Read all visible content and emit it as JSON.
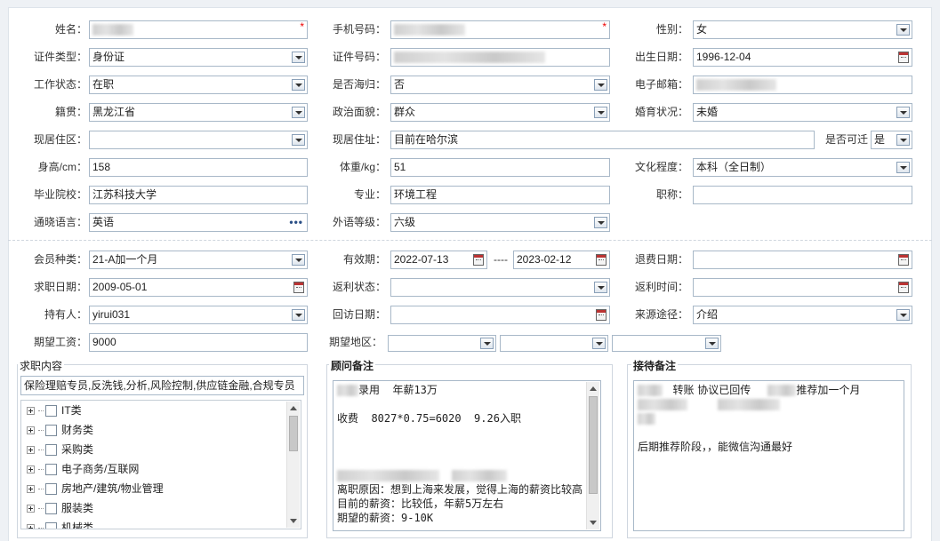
{
  "personal": {
    "name_label": "姓名：",
    "phone_label": "手机号码：",
    "gender_label": "性别：",
    "gender_value": "女",
    "id_type_label": "证件类型：",
    "id_type_value": "身份证",
    "id_no_label": "证件号码：",
    "birth_label": "出生日期：",
    "birth_value": "1996-12-04",
    "work_status_label": "工作状态：",
    "work_status_value": "在职",
    "overseas_label": "是否海归：",
    "overseas_value": "否",
    "email_label": "电子邮箱：",
    "native_label": "籍贯：",
    "native_value": "黑龙江省",
    "political_label": "政治面貌：",
    "political_value": "群众",
    "marital_label": "婚育状况：",
    "marital_value": "未婚",
    "residence_label": "现居住区：",
    "residence_value": "",
    "address_label": "现居住址：",
    "address_value": "目前在哈尔滨",
    "relocate_label": "是否可迁",
    "relocate_value": "是",
    "height_label": "身高/cm：",
    "height_value": "158",
    "weight_label": "体重/kg：",
    "weight_value": "51",
    "education_label": "文化程度：",
    "education_value": "本科（全日制）",
    "school_label": "毕业院校：",
    "school_value": "江苏科技大学",
    "major_label": "专业：",
    "major_value": "环境工程",
    "title_label": "职称：",
    "title_value": "",
    "language_label": "通晓语言：",
    "language_value": "英语",
    "language_more": "•••",
    "lang_level_label": "外语等级：",
    "lang_level_value": "六级"
  },
  "membership": {
    "type_label": "会员种类：",
    "type_value": "21-A加一个月",
    "validity_label": "有效期：",
    "validity_from": "2022-07-13",
    "validity_sep": "----",
    "validity_to": "2023-02-12",
    "refund_date_label": "退费日期：",
    "refund_date_value": "",
    "job_date_label": "求职日期：",
    "job_date_value": "2009-05-01",
    "rebate_status_label": "返利状态：",
    "rebate_status_value": "",
    "rebate_time_label": "返利时间：",
    "rebate_time_value": "",
    "holder_label": "持有人：",
    "holder_value": "yirui031",
    "visit_date_label": "回访日期：",
    "visit_date_value": "",
    "source_label": "来源途径：",
    "source_value": "介绍",
    "salary_label": "期望工资：",
    "salary_value": "9000",
    "region_label": "期望地区："
  },
  "job_content": {
    "legend": "求职内容",
    "summary": "保险理赔专员,反洗钱,分析,风险控制,供应链金融,合规专员",
    "categories": [
      "IT类",
      "财务类",
      "采购类",
      "电子商务/互联网",
      "房地产/建筑/物业管理",
      "服装类",
      "机械类"
    ]
  },
  "consultant_notes": {
    "legend": "顾问备注",
    "line1_suffix": "录用  年薪13万",
    "line2": "收费  8027*0.75=6020  9.26入职",
    "line3": "离职原因：想到上海来发展，觉得上海的薪资比较高",
    "line4": "目前的薪资：比较低，年薪5万左右",
    "line5": "期望的薪资：9-10K"
  },
  "reception_notes": {
    "legend": "接待备注",
    "line1_a": "转账 协议已回传",
    "line1_b": "推荐加一个月",
    "line2": "后期推荐阶段，，能微信沟通最好"
  },
  "icons": {
    "dropdown": "chevron-down-icon",
    "calendar": "calendar-icon",
    "required": "*"
  }
}
